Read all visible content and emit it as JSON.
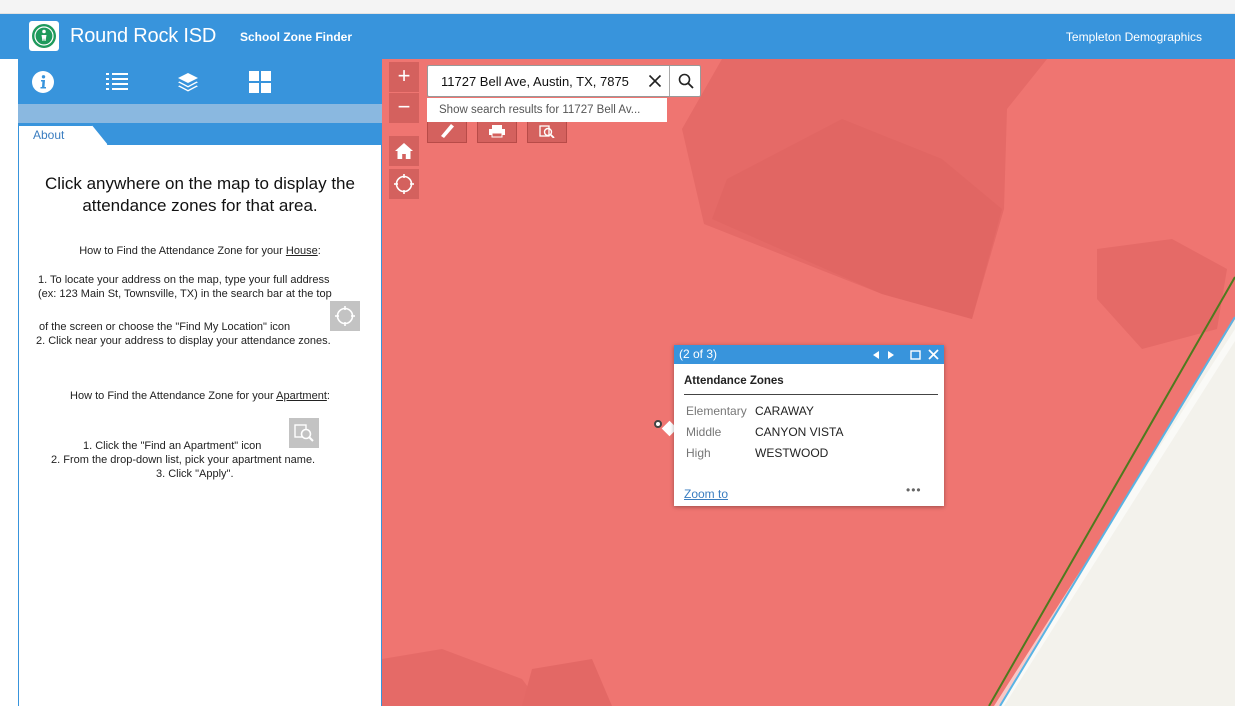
{
  "header": {
    "title": "Round Rock ISD",
    "subtitle": "School Zone Finder",
    "right_text": "Templeton Demographics",
    "bg_color": "#3894dc"
  },
  "toolbar": {
    "items": [
      {
        "icon": "info-icon"
      },
      {
        "icon": "legend-list-icon"
      },
      {
        "icon": "layers-icon"
      },
      {
        "icon": "basemap-grid-icon"
      }
    ]
  },
  "panel": {
    "tab_label": "About",
    "lead_text": "Click anywhere on the map to display the attendance zones for that area.",
    "house": {
      "heading_prefix": "How to Find the Attendance Zone for your ",
      "heading_link": "House",
      "heading_suffix": ":",
      "step1_line1": "1. To locate your address on the map, type your full address",
      "step1_line2": "(ex: 123 Main St, Townsville, TX) in the search bar at the top",
      "step1_line3": "of the screen or choose the \"Find My Location\" icon",
      "step2": "2. Click near your address to display your attendance zones."
    },
    "apartment": {
      "heading_prefix": "How to Find the Attendance Zone for your ",
      "heading_link": "Apartment",
      "heading_suffix": ":",
      "step1": "1. Click the \"Find an Apartment\" icon",
      "step2": "2. From the drop-down list, pick your apartment name.",
      "step3": "3. Click \"Apply\"."
    }
  },
  "map": {
    "zone_color": "#ef7571",
    "search_value": "11727 Bell Ave, Austin, TX, 7875",
    "suggestion": "Show search results for 11727 Bell Av...",
    "zoom_in": "+",
    "zoom_out": "−"
  },
  "popup": {
    "counter": "(2 of 3)",
    "title": "Attendance Zones",
    "rows": [
      {
        "label": "Elementary",
        "value": "CARAWAY"
      },
      {
        "label": "Middle",
        "value": "CANYON VISTA"
      },
      {
        "label": "High",
        "value": "WESTWOOD"
      }
    ],
    "zoom_link": "Zoom to",
    "more": "•••"
  }
}
